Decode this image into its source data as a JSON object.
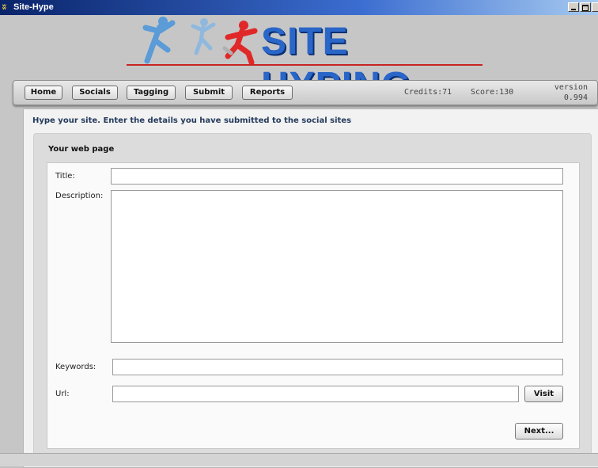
{
  "window": {
    "title": "Site-Hype",
    "icon": "app-logo-icon",
    "icon_glyph": "ʬ"
  },
  "banner": {
    "logo_text": "SITE HYPING",
    "figures": [
      "running-figure-blue-icon",
      "running-figure-blue-icon",
      "running-figure-red-icon"
    ],
    "colors": {
      "logo": "#2a66c8",
      "underline": "#c82424"
    }
  },
  "nav": {
    "home": "Home",
    "socials": "Socials",
    "tagging": "Tagging",
    "submit": "Submit",
    "reports": "Reports"
  },
  "status": {
    "credits": "Credits:71",
    "score": "Score:130",
    "version_label": "version",
    "version_number": "0.994"
  },
  "main": {
    "intro": "Hype your site. Enter the details you have submitted to the social sites",
    "card_title": "Your web page",
    "fields": {
      "title_label": "Title:",
      "title_value": "",
      "description_label": "Description:",
      "description_value": "",
      "keywords_label": "Keywords:",
      "keywords_value": "",
      "url_label": "Url:",
      "url_value": ""
    },
    "visit_button": "Visit",
    "next_button": "Next..."
  }
}
